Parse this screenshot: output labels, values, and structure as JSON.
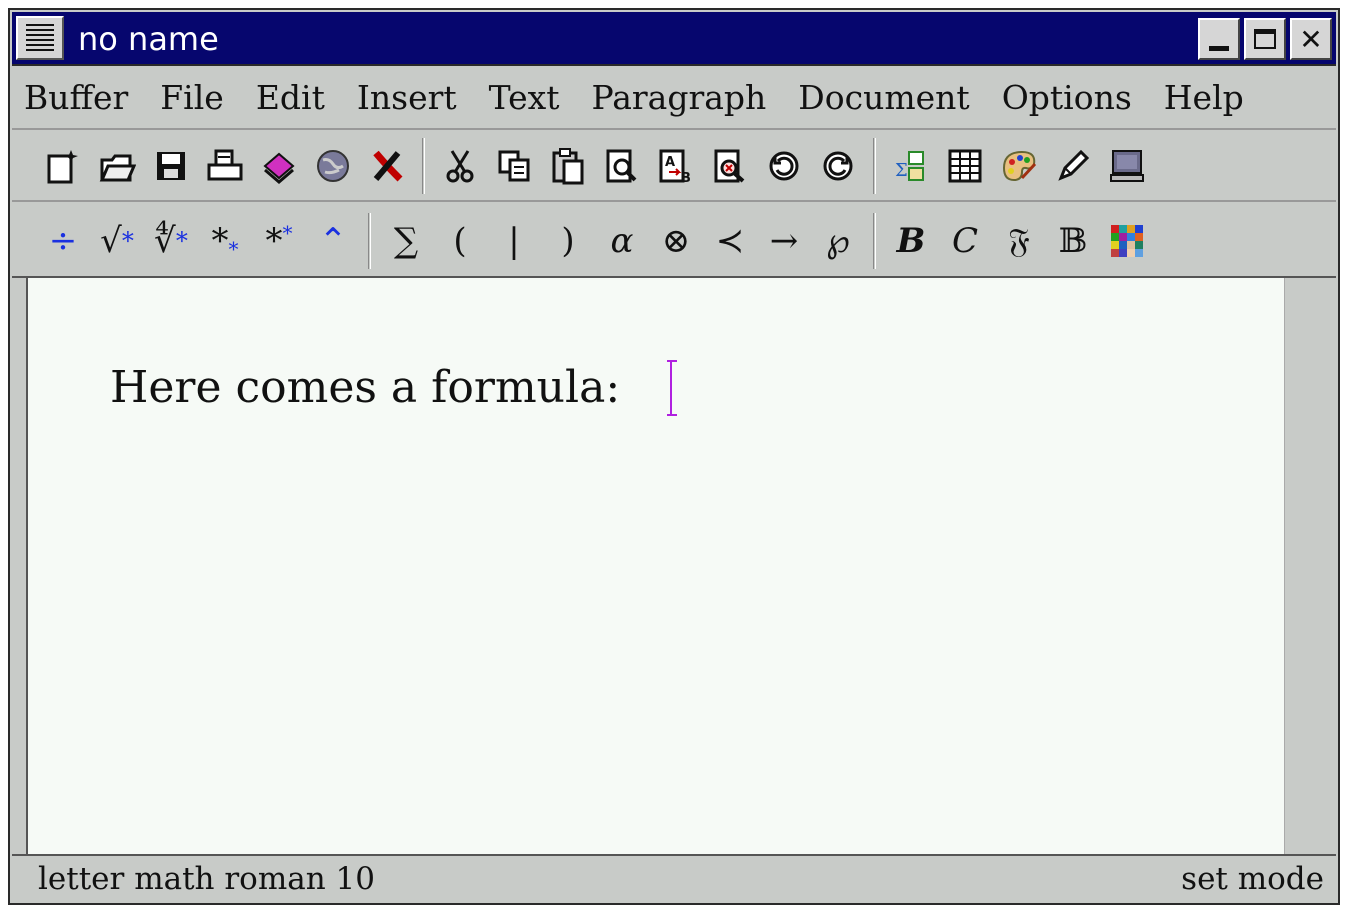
{
  "window": {
    "title": "no name"
  },
  "menubar": {
    "items": [
      "Buffer",
      "File",
      "Edit",
      "Insert",
      "Text",
      "Paragraph",
      "Document",
      "Options",
      "Help"
    ]
  },
  "toolbar_main": {
    "icons": [
      "new-document-icon",
      "open-icon",
      "save-icon",
      "print-icon",
      "books-icon",
      "globe-icon",
      "close-x-icon",
      "cut-icon",
      "copy-icon",
      "paste-icon",
      "search-icon",
      "replace-icon",
      "find-delete-icon",
      "undo-icon",
      "redo-icon",
      "math-mode-icon",
      "table-icon",
      "palette-icon",
      "pen-icon",
      "monitor-icon"
    ]
  },
  "toolbar_math": {
    "fraction": "÷",
    "sqrt": "√",
    "nthroot": "∜",
    "subscript": "*",
    "subscript_small": "*",
    "superscript": "*",
    "superscript_small": "*",
    "hat": "⌃",
    "sum": "∑",
    "lparen": "(",
    "bar": "|",
    "rparen": ")",
    "alpha": "α",
    "otimes": "⊗",
    "prec": "≺",
    "rightarrow": "→",
    "wp": "℘",
    "bold": "B",
    "calligraphic": "C",
    "fraktur": "𝔉",
    "blackboard": "𝔹",
    "colors_icon": "color-grid-icon"
  },
  "document": {
    "text": "Here comes a formula:"
  },
  "statusbar": {
    "left": "letter math roman 10",
    "right": "set mode"
  },
  "colors": {
    "titlebar": "#06066e",
    "chrome": "#c8cbc8",
    "page": "#f6faf6",
    "cursor": "#b020e0",
    "math_blue": "#1a30e0"
  }
}
